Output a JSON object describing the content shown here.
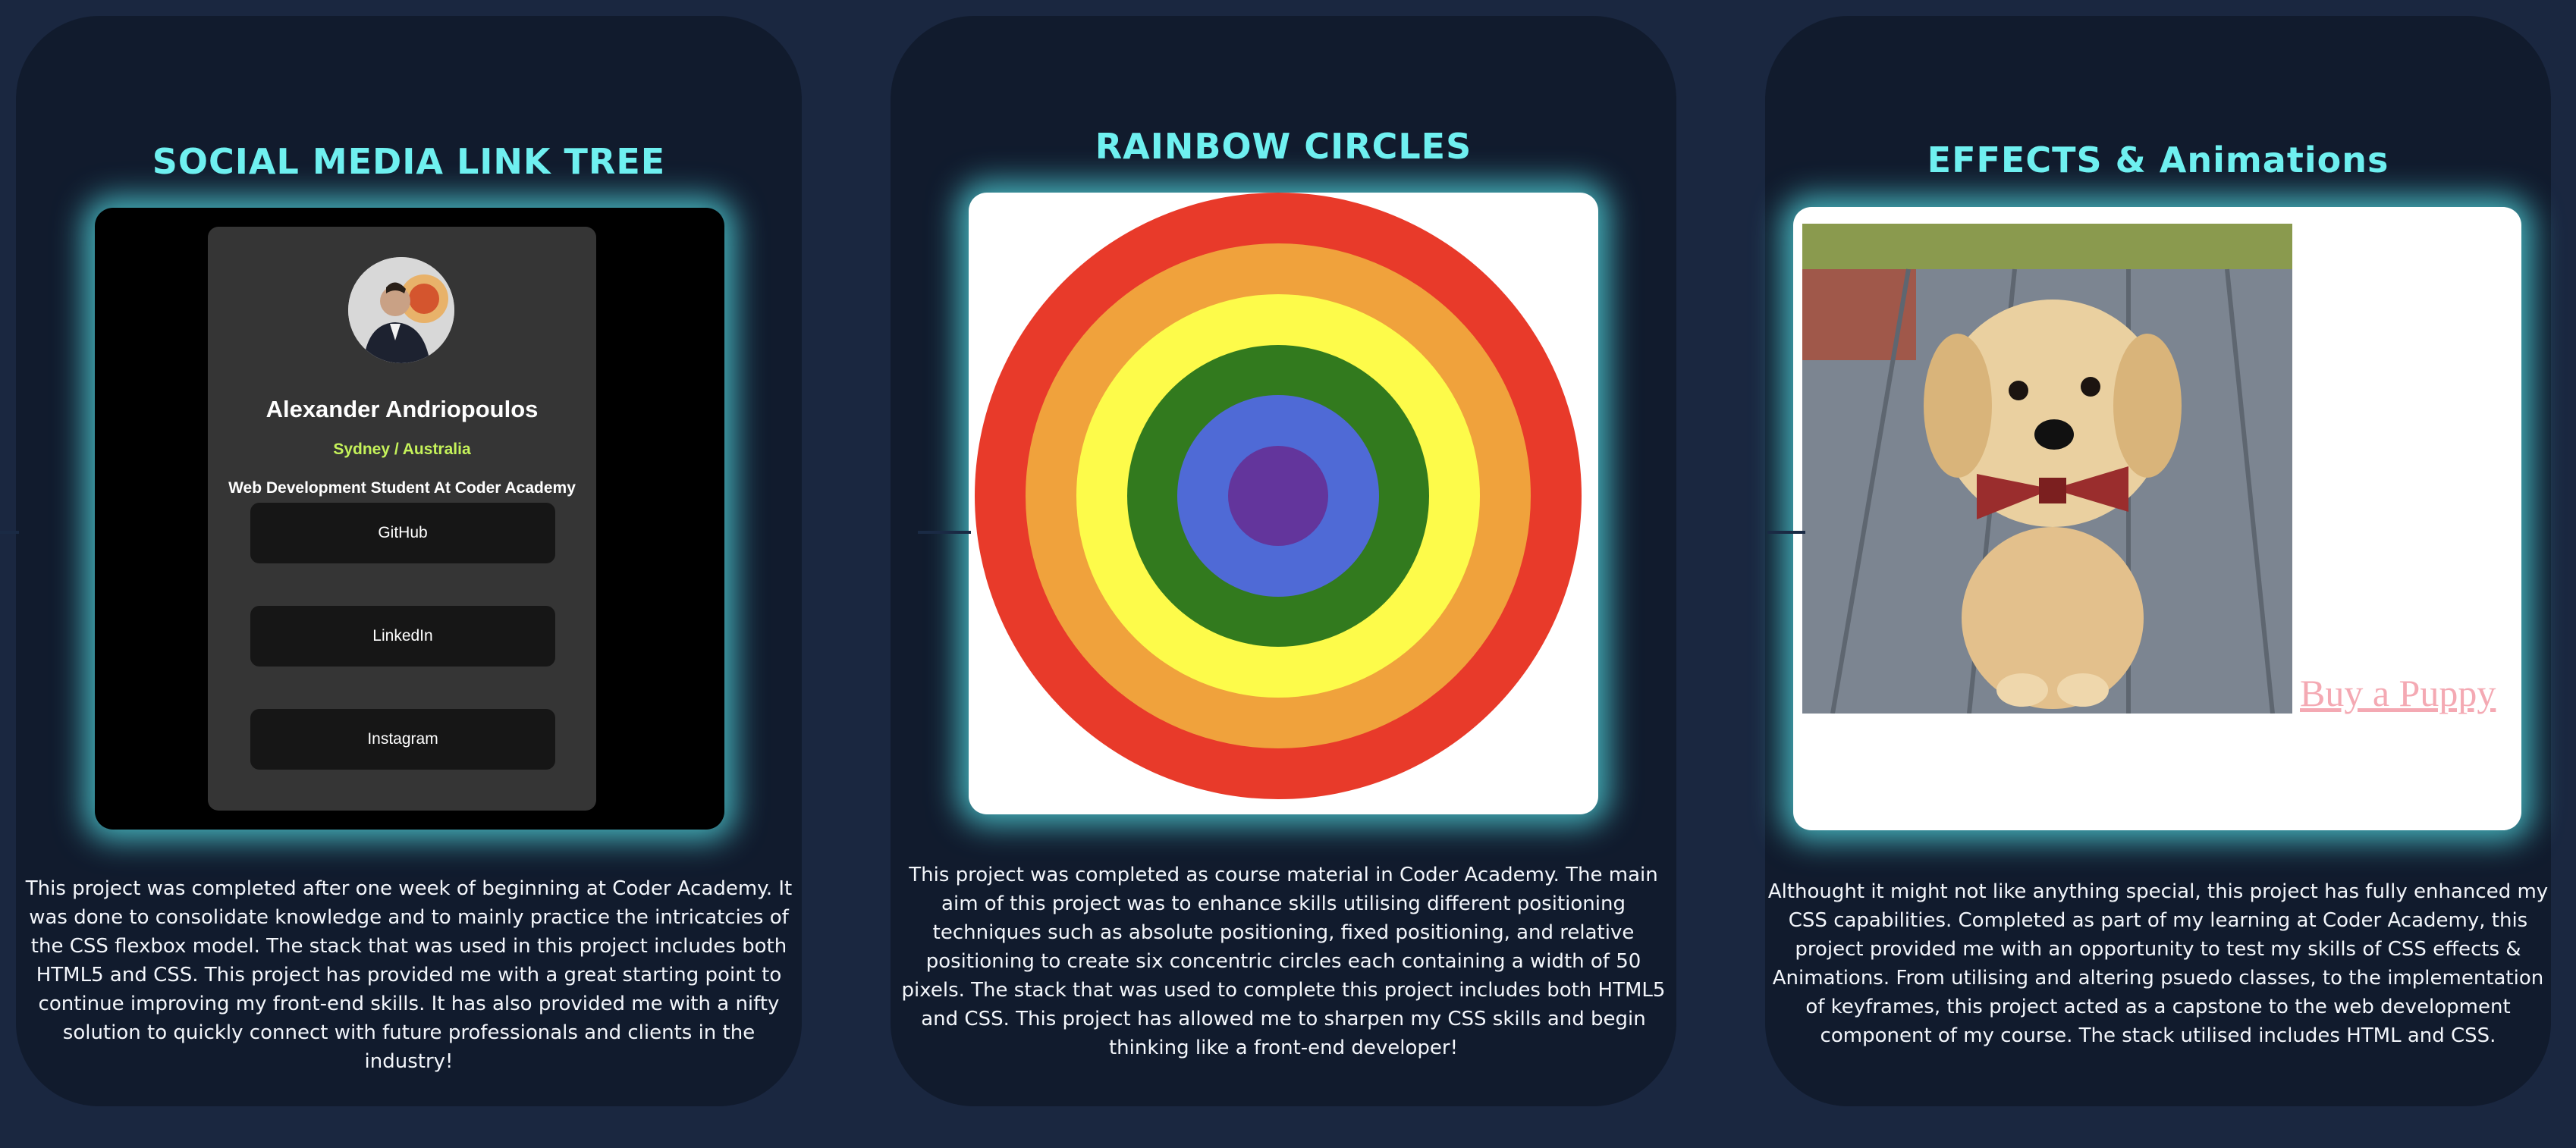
{
  "projects": [
    {
      "title": "SOCIAL MEDIA LINK TREE",
      "preview": {
        "name": "Alexander Andriopoulos",
        "location": "Sydney / Australia",
        "role": "Web Development Student At Coder Academy",
        "links": [
          "GitHub",
          "LinkedIn",
          "Instagram"
        ]
      },
      "description": "This project was completed after one week of beginning at Coder Academy. It was done to consolidate knowledge and to mainly practice the intricatcies of the CSS flexbox model. The stack that was used in this project includes both HTML5 and CSS. This project has provided me with a great starting point to continue improving my front-end skills. It has also provided me with a nifty solution to quickly connect with future professionals and clients in the industry!"
    },
    {
      "title": "RAINBOW CIRCLES",
      "preview": {
        "ring_colors": [
          "#e83a2a",
          "#f0a23c",
          "#fdfb4a",
          "#327a1e",
          "#4f6ad6",
          "#63359c"
        ]
      },
      "description": "This project was completed as course material in Coder Academy. The main aim of this project was to enhance skills utilising different positioning techniques such as absolute positioning, fixed positioning, and relative positioning to create six concentric circles each containing a width of 50 pixels. The stack that was used to complete this project includes both HTML5 and CSS. This project has allowed me to sharpen my CSS skills and begin thinking like a front-end developer!"
    },
    {
      "title": "EFFECTS & Animations",
      "preview": {
        "link_text": "Buy a Puppy"
      },
      "description": "Althought it might not like anything special, this project has fully enhanced my CSS capabilities. Completed as part of my learning at Coder Academy, this project provided me with an opportunity to test my skills of CSS effects & Animations. From utilising and altering psuedo classes, to the implementation of keyframes, this project acted as a capstone to the web development component of my course. The stack utilised includes HTML and CSS."
    }
  ],
  "colors": {
    "page_bg": "#1a2740",
    "card_bg": "#111b2d",
    "title": "#6ff0f0",
    "glow": "#56e1e8",
    "accent_location": "#c5f25a",
    "buy_link": "#f4a9b3"
  }
}
